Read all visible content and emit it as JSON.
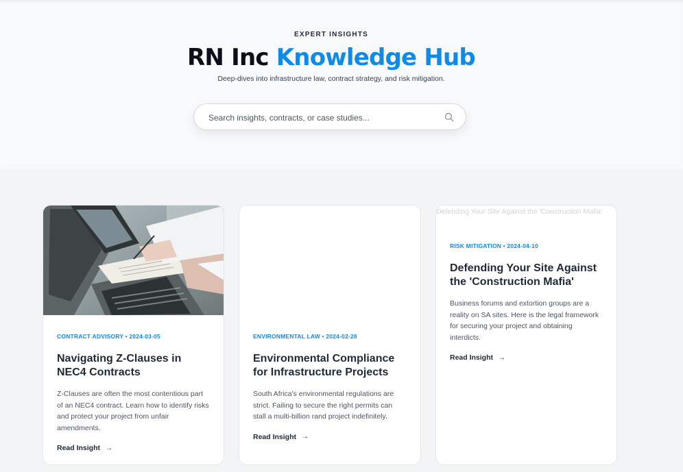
{
  "hero": {
    "eyebrow": "EXPERT INSIGHTS",
    "title_main": "RN Inc",
    "title_accent": "Knowledge Hub",
    "subtitle": "Deep-dives into infrastructure law, contract strategy, and risk mitigation.",
    "search_placeholder": "Search insights, contracts, or case studies...",
    "search_icon": "search-icon"
  },
  "colors": {
    "accent": "#0d8bea",
    "page_bg": "#f3f4f6",
    "card_bg": "#ffffff",
    "heading": "#1f2937"
  },
  "articles": [
    {
      "category": "CONTRACT ADVISORY",
      "date": "2024-03-05",
      "meta": "CONTRACT ADVISORY • 2024-03-05",
      "title": "Navigating Z-Clauses in NEC4 Contracts",
      "description": "Z-Clauses are often the most contentious part of an NEC4 contract. Learn how to identify risks and protect your project from unfair amendments.",
      "cta": "Read Insight",
      "cta_icon": "arrow-right-icon",
      "image": "photo of hands reviewing documents beside laptops"
    },
    {
      "category": "ENVIRONMENTAL LAW",
      "date": "2024-02-28",
      "meta": "ENVIRONMENTAL LAW • 2024-02-28",
      "title": "Environmental Compliance for Infrastructure Projects",
      "description": "South Africa's environmental regulations are strict. Failing to secure the right permits can stall a multi-billion rand project indefinitely.",
      "cta": "Read Insight",
      "cta_icon": "arrow-right-icon"
    },
    {
      "category": "RISK MITIGATION",
      "date": "2024-04-10",
      "meta": "RISK MITIGATION • 2024-04-10",
      "title": "Defending Your Site Against the 'Construction Mafia'",
      "description": "Business forums and extortion groups are a reality on SA sites. Here is the legal framework for securing your project and obtaining interdicts.",
      "cta": "Read Insight",
      "cta_icon": "arrow-right-icon",
      "image_alt": "Defending Your Site Against the 'Construction Mafia'"
    }
  ]
}
